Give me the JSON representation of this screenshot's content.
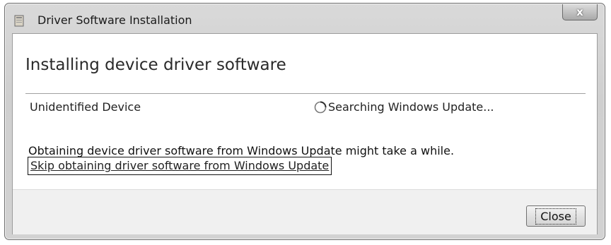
{
  "window": {
    "title": "Driver Software Installation",
    "title_icon": "driver-installer-icon",
    "close_glyph": "x"
  },
  "content": {
    "heading": "Installing device driver software",
    "device": {
      "name": "Unidentified Device",
      "status_icon": "spinner-icon",
      "status": "Searching Windows Update..."
    },
    "info": "Obtaining device driver software from Windows Update might take a while.",
    "skip_link": "Skip obtaining driver software from Windows Update"
  },
  "footer": {
    "close_label": "Close"
  },
  "colors": {
    "frame": "#d2d2d2",
    "client_bg": "#ffffff",
    "footer_bg": "#f0f0f0"
  }
}
